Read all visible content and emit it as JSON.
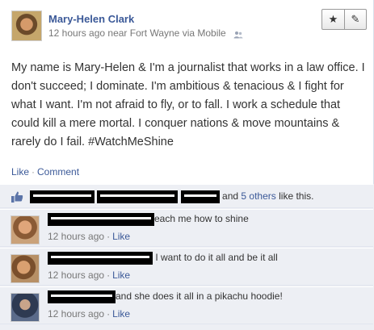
{
  "post": {
    "author": "Mary-Helen Clark",
    "timestamp": "12 hours ago",
    "location_prefix": "near",
    "location": "Fort Wayne",
    "via": "via Mobile",
    "body": "My name is Mary-Helen & I'm a journalist that works in a law office. I don't succeed; I dominate. I'm ambitious & tenacious & I fight for what I want. I'm not afraid to fly, or to fall. I work a schedule that could kill a mere mortal. I conquer nations & move mountains & rarely do I fail. #WatchMeShine",
    "like_label": "Like",
    "comment_label": "Comment",
    "separator": "·"
  },
  "actions": {
    "star_icon": "★",
    "edit_icon": "✎"
  },
  "likes": {
    "text_and": "and",
    "others_link": "5 others",
    "text_suffix": "like this."
  },
  "comments": [
    {
      "text": "each me how to shine",
      "time": "12 hours ago",
      "like_label": "Like",
      "avatar_color": "#b87a4b"
    },
    {
      "text": "I want to do it all and be it all",
      "time": "12 hours ago",
      "like_label": "Like",
      "avatar_color": "#9a7148"
    },
    {
      "text": "and she does it all in a pikachu hoodie!",
      "time": "12 hours ago",
      "like_label": "Like",
      "avatar_color": "#3d4b63"
    }
  ],
  "colors": {
    "link": "#3b5998",
    "ufi_background": "#edeff4"
  }
}
